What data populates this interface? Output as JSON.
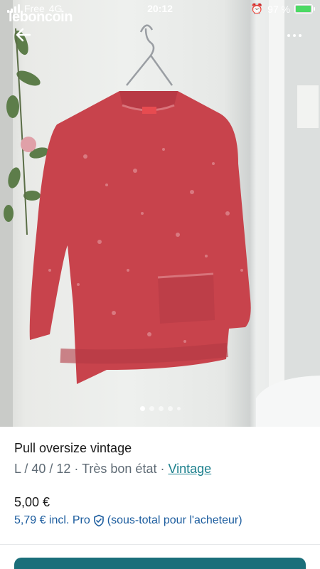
{
  "status": {
    "carrier": "Free",
    "network": "4G",
    "time": "20:12",
    "battery": "97 %",
    "battery_level": 0.97
  },
  "app": {
    "logo": "leboncoin"
  },
  "nav": {
    "back_icon": "arrow-left-icon",
    "more_icon": "more-dots-icon"
  },
  "gallery": {
    "image_count": 5,
    "active_index": 0
  },
  "listing": {
    "title": "Pull oversize vintage",
    "size_line": "L / 40 / 12 · Très bon état · ",
    "category": "Vintage",
    "price": "5,00 €",
    "pro_price": "5,79 € incl. Pro",
    "pro_note": "(sous-total pour l'acheteur)"
  },
  "colors": {
    "accent": "#1b6f7a",
    "link": "#1b7f8c",
    "pro": "#1b5c9e",
    "sweater": "#c8434c"
  }
}
